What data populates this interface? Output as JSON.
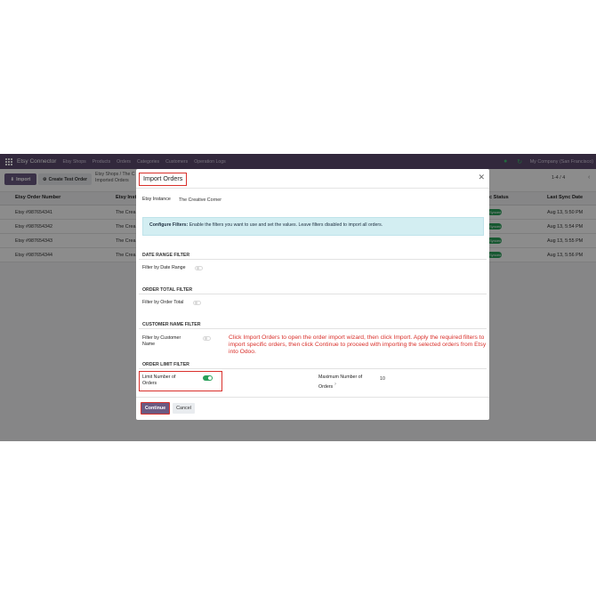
{
  "navbar": {
    "brand": "Etsy Connector",
    "items": [
      "Etsy Shops",
      "Products",
      "Orders",
      "Categories",
      "Customers",
      "Operation Logs"
    ],
    "company": "My Company (San Francisco)"
  },
  "control": {
    "import_label": "Import",
    "create_label": "Create Test Order",
    "breadcrumb_1": "Etsy Shops / The C",
    "breadcrumb_2": "Imported Orders",
    "pager": "1-4 / 4"
  },
  "list": {
    "headers": {
      "order": "Etsy Order Number",
      "instance": "Etsy Inst",
      "status": "c Status",
      "sync": "Last Sync Date"
    },
    "rows": [
      {
        "order": "Etsy #987654341",
        "instance": "The Crea",
        "sync": "Aug 13, 5:50 PM"
      },
      {
        "order": "Etsy #987654342",
        "instance": "The Crea",
        "sync": "Aug 13, 5:54 PM"
      },
      {
        "order": "Etsy #987654343",
        "instance": "The Crea",
        "sync": "Aug 13, 5:55 PM"
      },
      {
        "order": "Etsy #987654344",
        "instance": "The Crea",
        "sync": "Aug 13, 5:56 PM"
      }
    ],
    "badge": "Synced"
  },
  "modal": {
    "title": "Import Orders",
    "instance_label": "Etsy Instance",
    "instance_value": "The Creative Corner",
    "info_bold": "Configure Filters:",
    "info_text": "Enable the filters you want to use and set the values. Leave filters disabled to import all orders.",
    "sections": {
      "date": "DATE RANGE FILTER",
      "total": "ORDER TOTAL FILTER",
      "customer": "CUSTOMER NAME FILTER",
      "limit": "ORDER LIMIT FILTER"
    },
    "fields": {
      "date": "Filter by Date Range",
      "total": "Filter by Order Total",
      "customer": "Filter by Customer Name",
      "limit": "Limit Number of Orders",
      "max_label": "Maximum Number of Orders",
      "max_help": "?",
      "max_value": "10"
    },
    "toggles": {
      "date": false,
      "total": false,
      "customer": false,
      "limit": true
    },
    "instruction": "Click Import Orders to open the order import wizard, then click Import. Apply the required filters to import specific orders, then click Continue to proceed with importing the selected orders from Etsy into Odoo.",
    "continue_label": "Continue",
    "cancel_label": "Cancel"
  },
  "colors": {
    "navbar": "#5b4a6e",
    "primary": "#6b5a82",
    "highlight": "#d9302b",
    "success": "#2aa05a",
    "info": "#d3eef2"
  }
}
